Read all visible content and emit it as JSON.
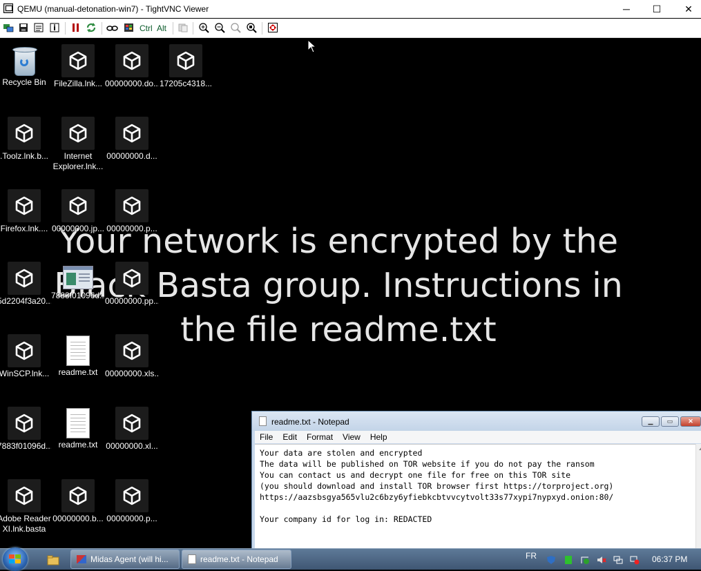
{
  "window": {
    "title": "QEMU (manual-detonation-win7) - TightVNC Viewer",
    "minimize_glyph": "─",
    "maximize_glyph": "☐",
    "close_glyph": "✕"
  },
  "toolbar": {
    "ctrl_label": "Ctrl",
    "alt_label": "Alt"
  },
  "desktop": {
    "icons": [
      {
        "label": "Recycle Bin",
        "type": "recycle-bin"
      },
      {
        "label": "FileZilla.lnk...",
        "type": "basta"
      },
      {
        "label": "00000000.do...",
        "type": "basta"
      },
      {
        "label": "17205c4318...",
        "type": "basta"
      },
      {
        "label": ".Toolz.lnk.b...",
        "type": "basta"
      },
      {
        "label": "Internet Explorer.lnk...",
        "type": "basta"
      },
      {
        "label": "00000000.d...",
        "type": "basta"
      },
      {
        "label": "Firefox.lnk....",
        "type": "basta"
      },
      {
        "label": "00000000.jp...",
        "type": "basta"
      },
      {
        "label": "00000000.p...",
        "type": "basta"
      },
      {
        "label": "5d2204f3a20...",
        "type": "basta"
      },
      {
        "label": "7883f01096d...",
        "type": "image"
      },
      {
        "label": "00000000.pp...",
        "type": "basta"
      },
      {
        "label": "WinSCP.lnk...",
        "type": "basta"
      },
      {
        "label": "readme.txt",
        "type": "text"
      },
      {
        "label": "00000000.xls...",
        "type": "basta"
      },
      {
        "label": "7883f01096d...",
        "type": "basta"
      },
      {
        "label": "readme.txt",
        "type": "text"
      },
      {
        "label": "00000000.xl...",
        "type": "basta"
      },
      {
        "label": "Adobe Reader XI.lnk.basta",
        "type": "basta"
      },
      {
        "label": "00000000.b...",
        "type": "basta"
      },
      {
        "label": "00000000.p...",
        "type": "basta"
      }
    ],
    "wallpaper_text": "Your network is encrypted by the Black Basta group. Instructions in the file readme.txt"
  },
  "notepad": {
    "title": "readme.txt - Notepad",
    "menu": [
      "File",
      "Edit",
      "Format",
      "View",
      "Help"
    ],
    "content": "Your data are stolen and encrypted\nThe data will be published on TOR website if you do not pay the ransom\nYou can contact us and decrypt one file for free on this TOR site\n(you should download and install TOR browser first https://torproject.org)\nhttps://aazsbsgya565vlu2c6bzy6yfiebkcbtvvcytvolt33s77xypi7nypxyd.onion:80/\n\nYour company id for log in: REDACTED"
  },
  "taskbar": {
    "items": [
      {
        "label": "Midas Agent (will hi...",
        "active": false
      },
      {
        "label": "readme.txt - Notepad",
        "active": true
      }
    ],
    "language": "FR",
    "clock": "06:37 PM"
  }
}
